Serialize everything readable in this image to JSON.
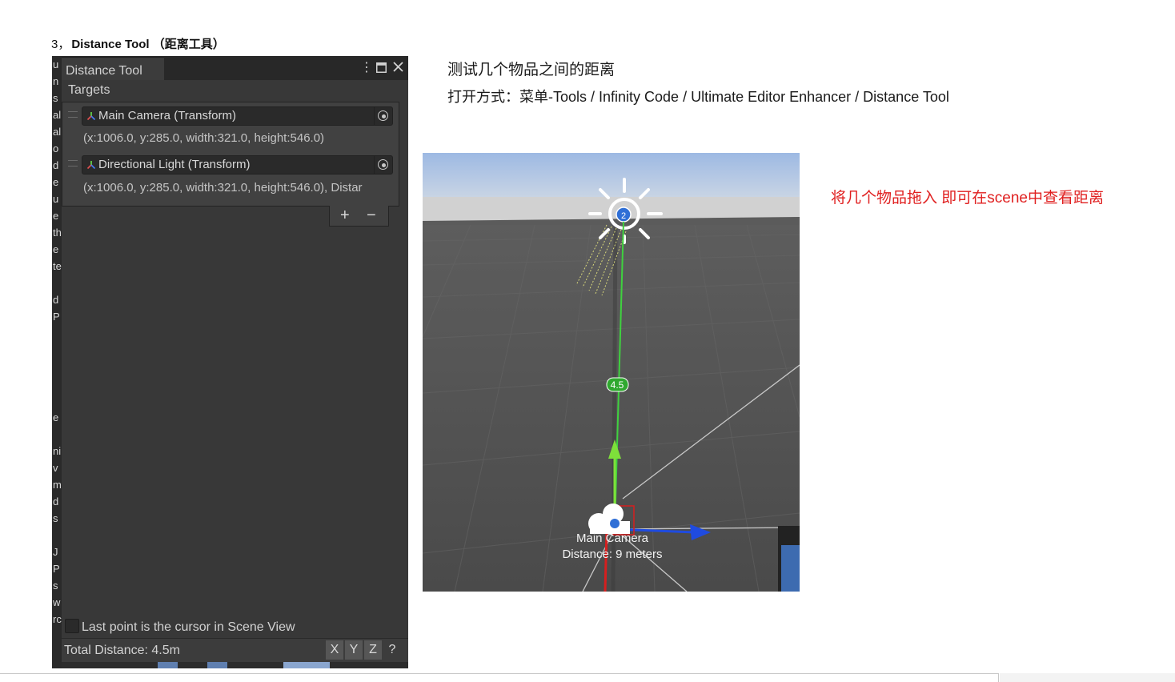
{
  "heading": {
    "number": "3，",
    "title": "Distance Tool",
    "subtitle": "（距离工具）"
  },
  "editor": {
    "tab_title": "Distance Tool",
    "menu_icon": "kebab-menu-icon",
    "maximize_icon": "maximize-icon",
    "close_icon": "close-icon",
    "targets_label": "Targets",
    "targets": [
      {
        "name": "Main Camera (Transform)",
        "rect": "(x:1006.0, y:285.0, width:321.0, height:546.0)"
      },
      {
        "name": "Directional Light (Transform)",
        "rect": "(x:1006.0, y:285.0, width:321.0, height:546.0), Distar"
      }
    ],
    "add_label": "+",
    "remove_label": "−",
    "cursor_checkbox_label": "Last point is the cursor in Scene View",
    "cursor_checkbox_checked": false,
    "total_distance": "Total Distance: 4.5m",
    "axis_buttons": [
      "X",
      "Y",
      "Z",
      "?"
    ],
    "left_strip_chars": [
      "u",
      "n",
      "s",
      "al",
      "al",
      "o",
      "d",
      "e",
      "u",
      "e",
      "th",
      "e",
      "te",
      "",
      "d",
      "P",
      "",
      "",
      "",
      "",
      "",
      "e",
      "",
      "ni",
      "v",
      "m",
      "d",
      "s",
      "",
      "J",
      "P",
      "s",
      "w",
      "rc"
    ]
  },
  "description": {
    "line1": "测试几个物品之间的距离",
    "line2": "打开方式：菜单-Tools / Infinity Code / Ultimate Editor Enhancer / Distance Tool"
  },
  "note": "将几个物品拖入  即可在scene中查看距离",
  "scene": {
    "light_badge": "2",
    "distance_badge": "4.5",
    "camera_label_line1": "Main Camera",
    "camera_label_line2": "Distance: 9 meters",
    "colors": {
      "sky": "#aac4e6",
      "horizon": "#d0d0d0",
      "ground": "#535353",
      "line": "#3fd13f",
      "axis_y": "#7ee03a",
      "axis_z": "#1f4be0",
      "axis_x": "#d61f1f"
    }
  }
}
